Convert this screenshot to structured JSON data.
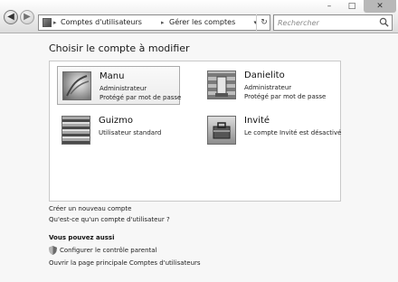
{
  "toolbar": {
    "breadcrumbs": [
      "Comptes d'utilisateurs",
      "Gérer les comptes"
    ],
    "search_placeholder": "Rechercher"
  },
  "main": {
    "heading": "Choisir le compte à modifier",
    "accounts": [
      {
        "name": "Manu",
        "lines": [
          "Administrateur",
          "Protégé par mot de passe"
        ],
        "avatar": "flower-avatar",
        "selected": true
      },
      {
        "name": "Danielito",
        "lines": [
          "Administrateur",
          "Protégé par mot de passe"
        ],
        "avatar": "chess-avatar",
        "selected": false
      },
      {
        "name": "Guizmo",
        "lines": [
          "Utilisateur standard"
        ],
        "avatar": "pattern-avatar",
        "selected": false
      },
      {
        "name": "Invité",
        "lines": [
          "Le compte Invité est désactivé"
        ],
        "avatar": "guest-briefcase-avatar",
        "selected": false
      }
    ],
    "links": {
      "create_account": "Créer un nouveau compte",
      "what_is_account": "Qu'est-ce qu'un compte d'utilisateur ?"
    },
    "see_also": {
      "title": "Vous pouvez aussi",
      "parental_control": "Configurer le contrôle parental",
      "main_page": "Ouvrir la page principale Comptes d'utilisateurs"
    }
  }
}
